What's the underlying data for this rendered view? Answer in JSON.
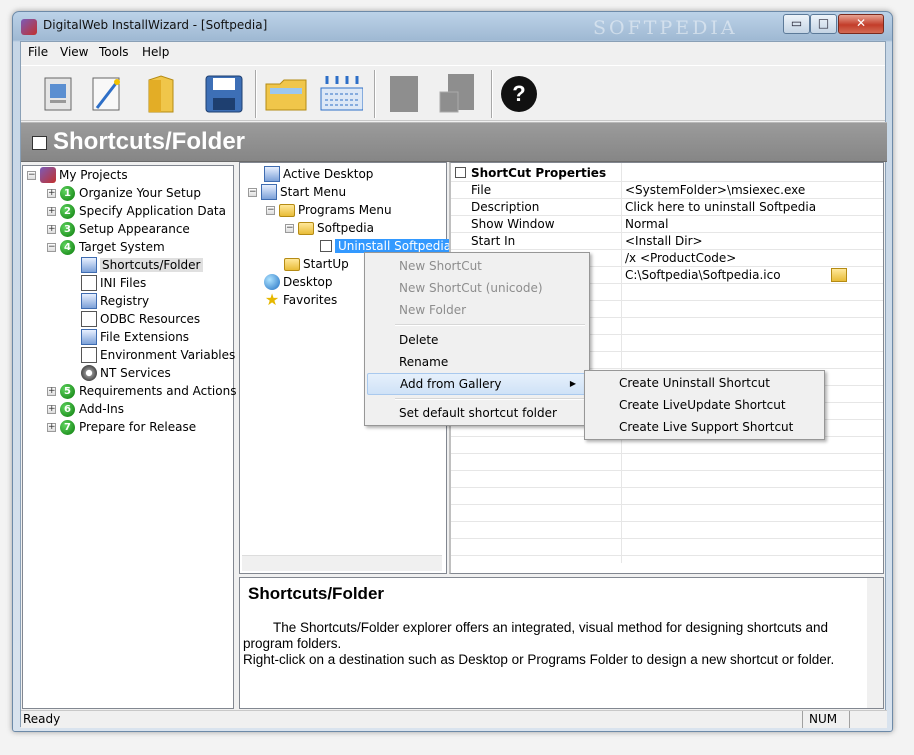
{
  "window": {
    "title": "DigitalWeb InstallWizard - [Softpedia]",
    "watermark": "SOFTPEDIA",
    "minimize_glyph": "▭",
    "maximize_glyph": "□",
    "close_glyph": "✕"
  },
  "menu": [
    "File",
    "View",
    "Tools",
    "Help"
  ],
  "toolbar": {
    "buttons": [
      "new-project-icon",
      "wizard-icon",
      "open-folder-icon",
      "save-icon",
      "explore-folder-icon",
      "build-icon",
      "copy-icon",
      "paste-icon",
      "help-icon"
    ],
    "help_glyph": "?"
  },
  "section_header": {
    "title": "Shortcuts/Folder"
  },
  "project_tree": {
    "root": "My Projects",
    "steps": [
      {
        "num": "1",
        "label": "Organize Your Setup"
      },
      {
        "num": "2",
        "label": "Specify Application Data"
      },
      {
        "num": "3",
        "label": "Setup Appearance"
      },
      {
        "num": "4",
        "label": "Target System"
      }
    ],
    "target_children": [
      "Shortcuts/Folder",
      "INI Files",
      "Registry",
      "ODBC Resources",
      "File Extensions",
      "Environment Variables",
      "NT Services"
    ],
    "steps_after": [
      {
        "num": "5",
        "label": "Requirements and Actions"
      },
      {
        "num": "6",
        "label": "Add-Ins"
      },
      {
        "num": "7",
        "label": "Prepare for Release"
      }
    ]
  },
  "folder_tree": {
    "active_desktop": "Active Desktop",
    "start_menu": "Start Menu",
    "programs_menu": "Programs Menu",
    "softpedia": "Softpedia",
    "uninstall": "Uninstall Softpedia",
    "startup": "StartUp",
    "desktop": "Desktop",
    "favorites": "Favorites"
  },
  "properties": {
    "heading": "ShortCut Properties",
    "rows": [
      {
        "key": "File",
        "value": "<SystemFolder>\\msiexec.exe"
      },
      {
        "key": "Description",
        "value": "Click here to uninstall Softpedia"
      },
      {
        "key": "Show Window",
        "value": "Normal"
      },
      {
        "key": "Start In",
        "value": "<Install Dir>"
      },
      {
        "key": "",
        "value": "/x <ProductCode>"
      },
      {
        "key": "",
        "value": "C:\\Softpedia\\Softpedia.ico"
      }
    ]
  },
  "context_menu": {
    "items": [
      "New ShortCut",
      "New ShortCut (unicode)",
      "New Folder",
      "Delete",
      "Rename",
      "Add from Gallery",
      "Set default shortcut folder"
    ]
  },
  "submenu": {
    "items": [
      "Create Uninstall Shortcut",
      "Create LiveUpdate Shortcut",
      "Create Live Support Shortcut"
    ]
  },
  "help": {
    "title": "Shortcuts/Folder",
    "p1": "The Shortcuts/Folder explorer offers an integrated, visual method for designing shortcuts and program folders.",
    "p2": "Right-click on a destination such as Desktop or Programs Folder to design a new shortcut or folder."
  },
  "status": {
    "left": "Ready",
    "num": "NUM"
  }
}
